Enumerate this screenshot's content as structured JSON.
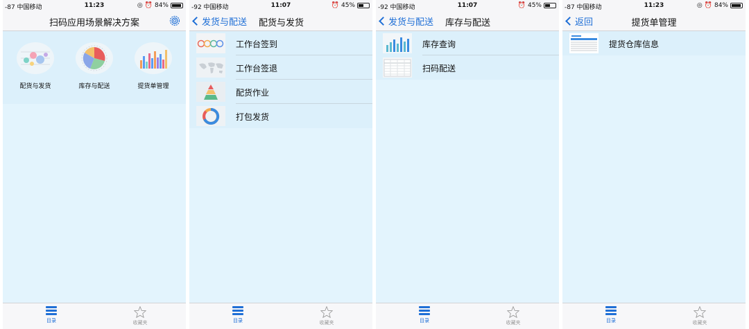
{
  "colors": {
    "accent": "#1f6fd6",
    "background": "#e3f4fd"
  },
  "screens": [
    {
      "status": {
        "signal": "-87 中国移动",
        "time": "11:23",
        "battery": "84%"
      },
      "nav": {
        "title": "扫码应用场景解决方案",
        "back": ""
      },
      "grid": [
        {
          "label": "配货与发货",
          "icon": "bubble-chart-icon"
        },
        {
          "label": "库存与配送",
          "icon": "pie-chart-icon"
        },
        {
          "label": "提货单管理",
          "icon": "bar-chart-icon"
        }
      ],
      "tabs": {
        "catalog": "目录",
        "favorites": "收藏夹"
      }
    },
    {
      "status": {
        "signal": "-92 中国移动",
        "time": "11:07",
        "battery": "45%"
      },
      "nav": {
        "title": "配货与发货",
        "back": "发货与配送"
      },
      "list": [
        {
          "label": "工作台签到",
          "icon": "gauge-dashboard-icon"
        },
        {
          "label": "工作台签退",
          "icon": "world-map-icon"
        },
        {
          "label": "配货作业",
          "icon": "pyramid-chart-icon"
        },
        {
          "label": "打包发货",
          "icon": "donut-chart-icon"
        }
      ],
      "tabs": {
        "catalog": "目录",
        "favorites": "收藏夹"
      }
    },
    {
      "status": {
        "signal": "-92 中国移动",
        "time": "11:07",
        "battery": "45%"
      },
      "nav": {
        "title": "库存与配送",
        "back": "发货与配送"
      },
      "list": [
        {
          "label": "库存查询",
          "icon": "bar-chart-icon"
        },
        {
          "label": "扫码配送",
          "icon": "table-icon"
        }
      ],
      "tabs": {
        "catalog": "目录",
        "favorites": "收藏夹"
      }
    },
    {
      "status": {
        "signal": "-87 中国移动",
        "time": "11:23",
        "battery": "84%"
      },
      "nav": {
        "title": "提货单管理",
        "back": "返回"
      },
      "list": [
        {
          "label": "提货仓库信息",
          "icon": "report-table-icon"
        }
      ],
      "tabs": {
        "catalog": "目录",
        "favorites": "收藏夹"
      }
    }
  ]
}
